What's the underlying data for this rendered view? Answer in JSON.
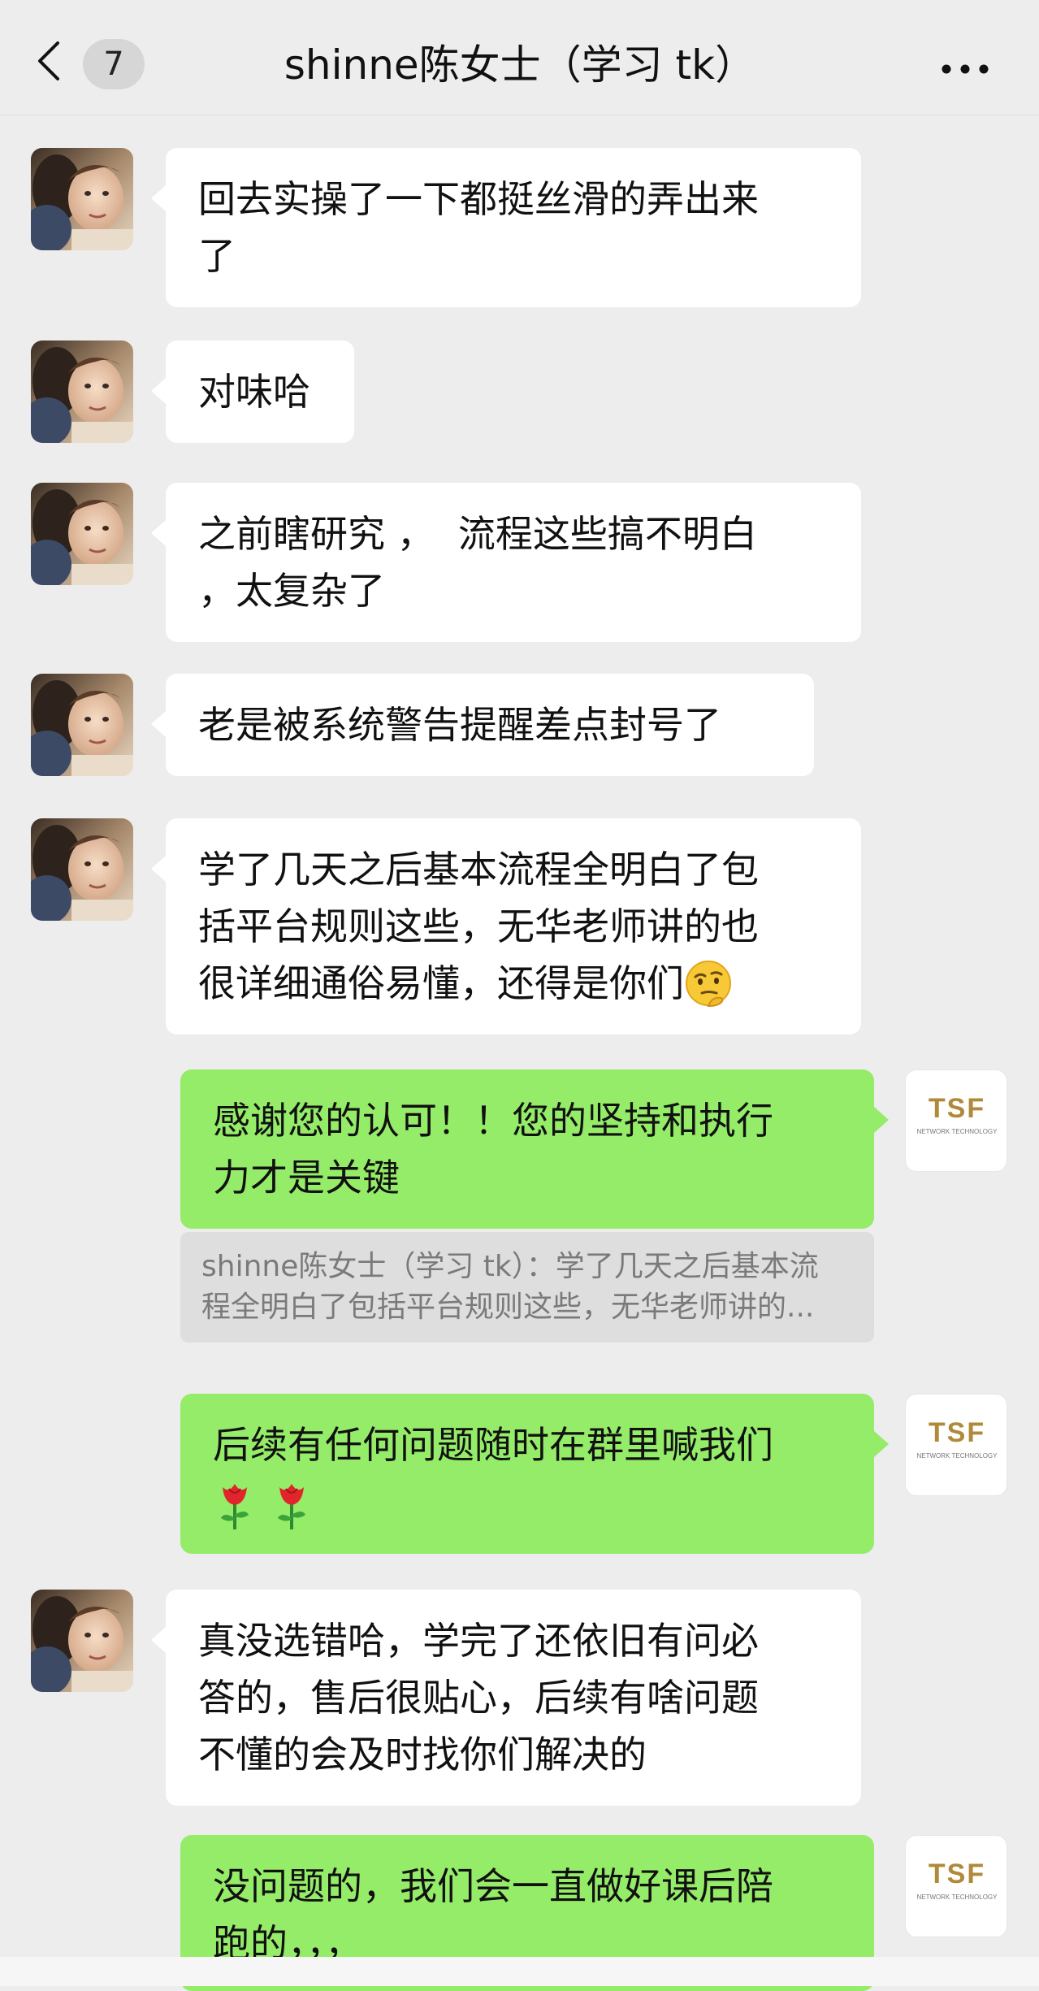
{
  "header": {
    "unread_count": "7",
    "title": "shinne陈女士（学习 tk）"
  },
  "colors": {
    "incoming_bubble": "#ffffff",
    "outgoing_bubble": "#95ec69",
    "background": "#ededed",
    "tsf_gold": "#b08a3a"
  },
  "logo": {
    "brand": "TSF",
    "sub": "NETWORK TECHNOLOGY"
  },
  "messages": [
    {
      "side": "in",
      "lines": [
        "回去实操了一下都挺丝滑的弄出来",
        "了"
      ]
    },
    {
      "side": "in",
      "lines": [
        "对味哈"
      ]
    },
    {
      "side": "in",
      "lines": [
        "之前瞎研究 ，  流程这些搞不明白",
        "，太复杂了"
      ]
    },
    {
      "side": "in",
      "lines": [
        "老是被系统警告提醒差点封号了"
      ]
    },
    {
      "side": "in",
      "lines": [
        "学了几天之后基本流程全明白了包",
        "括平台规则这些，无华老师讲的也",
        "很详细通俗易懂，还得是你们"
      ],
      "emoji": "thinking-face-icon"
    },
    {
      "side": "out",
      "lines": [
        "感谢您的认可！！您的坚持和执行",
        "力才是关键"
      ]
    },
    {
      "side": "quote",
      "lines": [
        "shinne陈女士（学习 tk）：学了几天之后基本流",
        "程全明白了包括平台规则这些，无华老师讲的..."
      ]
    },
    {
      "side": "out",
      "lines": [
        "后续有任何问题随时在群里喊我们"
      ],
      "emoji": "rose-icon"
    },
    {
      "side": "in",
      "lines": [
        "真没选错哈，学完了还依旧有问必",
        "答的，售后很贴心，后续有啥问题",
        "不懂的会及时找你们解决的"
      ]
    },
    {
      "side": "out",
      "lines": [
        "没问题的，我们会一直做好课后陪",
        "跑的，，，"
      ]
    }
  ]
}
